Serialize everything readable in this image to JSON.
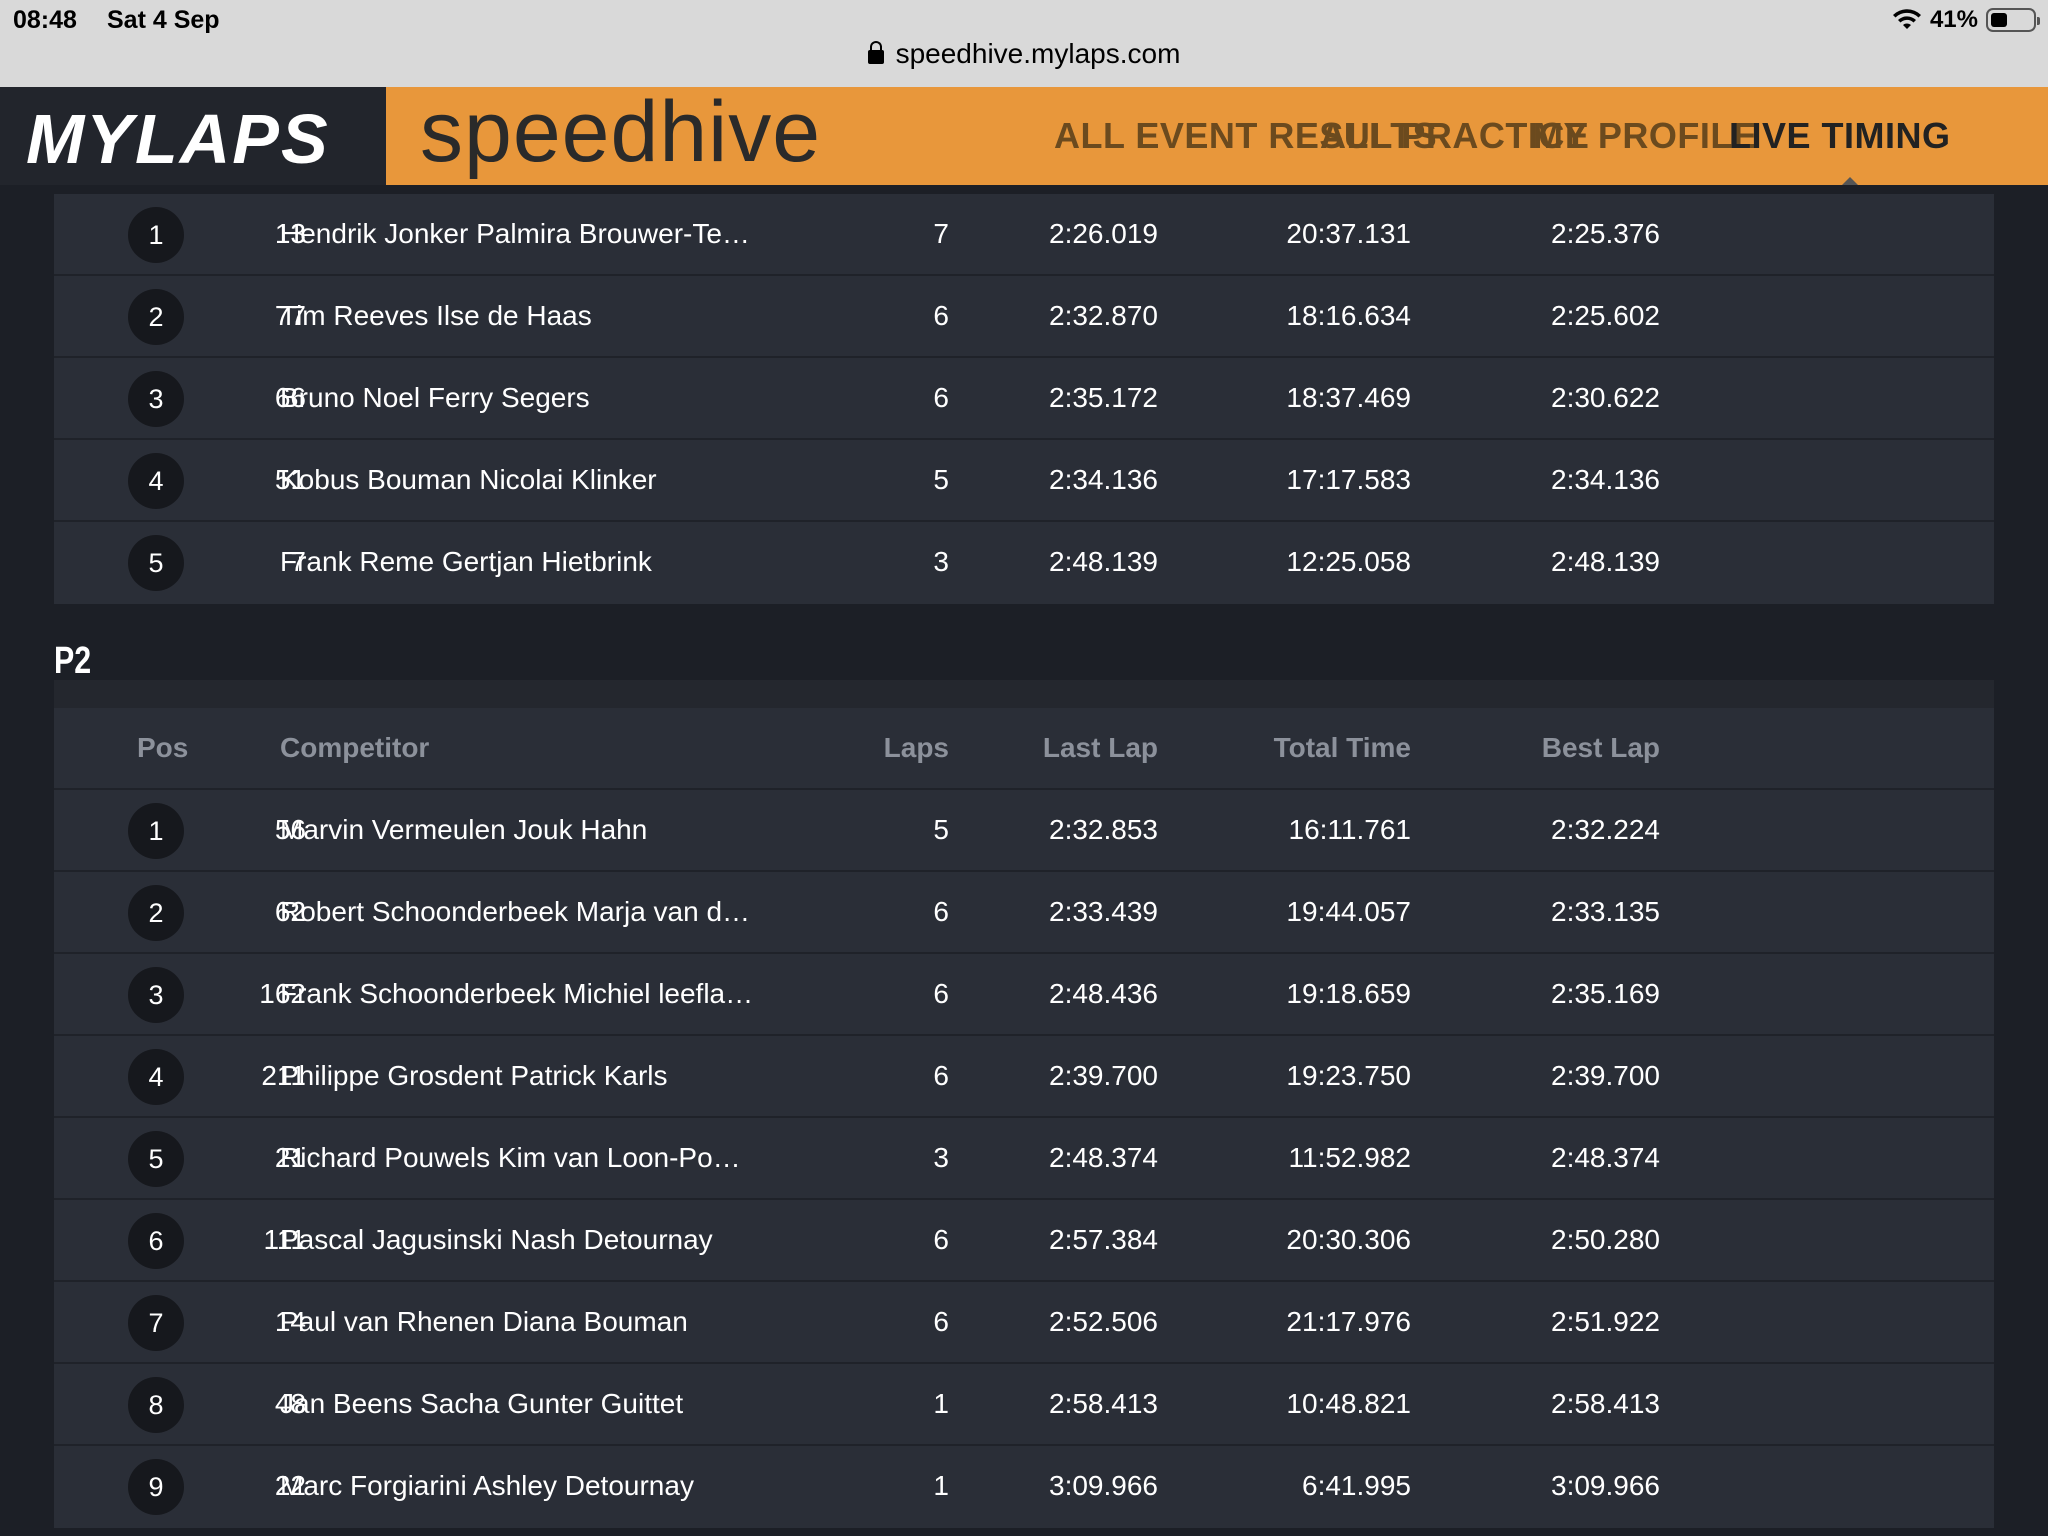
{
  "status_bar": {
    "time": "08:48",
    "date": "Sat 4 Sep",
    "battery": "41%",
    "battery_level": 0.41
  },
  "browser": {
    "url": "speedhive.mylaps.com"
  },
  "site": {
    "logo": "MYLAPS",
    "brand": "speedhive",
    "nav": [
      "ALL EVENT RESULTS",
      "ALL PRACTICE",
      "MY PROFILE",
      "LIVE TIMING"
    ],
    "active_nav": "LIVE TIMING"
  },
  "p1": {
    "rows": [
      {
        "pos": "1",
        "num": "13",
        "name": "Hendrik Jonker Palmira Brouwer-Te…",
        "laps": "7",
        "last": "2:26.019",
        "total": "20:37.131",
        "best": "2:25.376"
      },
      {
        "pos": "2",
        "num": "77",
        "name": "Tim Reeves Ilse de Haas",
        "laps": "6",
        "last": "2:32.870",
        "total": "18:16.634",
        "best": "2:25.602"
      },
      {
        "pos": "3",
        "num": "66",
        "name": "Bruno Noel Ferry Segers",
        "laps": "6",
        "last": "2:35.172",
        "total": "18:37.469",
        "best": "2:30.622"
      },
      {
        "pos": "4",
        "num": "51",
        "name": "Kobus Bouman Nicolai Klinker",
        "laps": "5",
        "last": "2:34.136",
        "total": "17:17.583",
        "best": "2:34.136"
      },
      {
        "pos": "5",
        "num": "7",
        "name": "Frank Reme Gertjan Hietbrink",
        "laps": "3",
        "last": "2:48.139",
        "total": "12:25.058",
        "best": "2:48.139"
      }
    ]
  },
  "p2": {
    "title": "P2",
    "headers": {
      "pos": "Pos",
      "competitor": "Competitor",
      "laps": "Laps",
      "last": "Last Lap",
      "total": "Total Time",
      "best": "Best Lap"
    },
    "rows": [
      {
        "pos": "1",
        "num": "56",
        "name": "Marvin Vermeulen Jouk Hahn",
        "laps": "5",
        "last": "2:32.853",
        "total": "16:11.761",
        "best": "2:32.224"
      },
      {
        "pos": "2",
        "num": "62",
        "name": "Robert Schoonderbeek Marja van d…",
        "laps": "6",
        "last": "2:33.439",
        "total": "19:44.057",
        "best": "2:33.135"
      },
      {
        "pos": "3",
        "num": "162",
        "name": "Frank Schoonderbeek Michiel leefla…",
        "laps": "6",
        "last": "2:48.436",
        "total": "19:18.659",
        "best": "2:35.169"
      },
      {
        "pos": "4",
        "num": "211",
        "name": "Philippe Grosdent Patrick Karls",
        "laps": "6",
        "last": "2:39.700",
        "total": "19:23.750",
        "best": "2:39.700"
      },
      {
        "pos": "5",
        "num": "21",
        "name": "Richard Pouwels Kim van Loon-Po…",
        "laps": "3",
        "last": "2:48.374",
        "total": "11:52.982",
        "best": "2:48.374"
      },
      {
        "pos": "6",
        "num": "111",
        "name": "Pascal Jagusinski Nash Detournay",
        "laps": "6",
        "last": "2:57.384",
        "total": "20:30.306",
        "best": "2:50.280"
      },
      {
        "pos": "7",
        "num": "14",
        "name": "Paul van Rhenen Diana Bouman",
        "laps": "6",
        "last": "2:52.506",
        "total": "21:17.976",
        "best": "2:51.922"
      },
      {
        "pos": "8",
        "num": "48",
        "name": "Jan Beens Sacha Gunter Guittet",
        "laps": "1",
        "last": "2:58.413",
        "total": "10:48.821",
        "best": "2:58.413"
      },
      {
        "pos": "9",
        "num": "22",
        "name": "Marc Forgiarini Ashley Detournay",
        "laps": "1",
        "last": "3:09.966",
        "total": "6:41.995",
        "best": "3:09.966"
      }
    ]
  }
}
